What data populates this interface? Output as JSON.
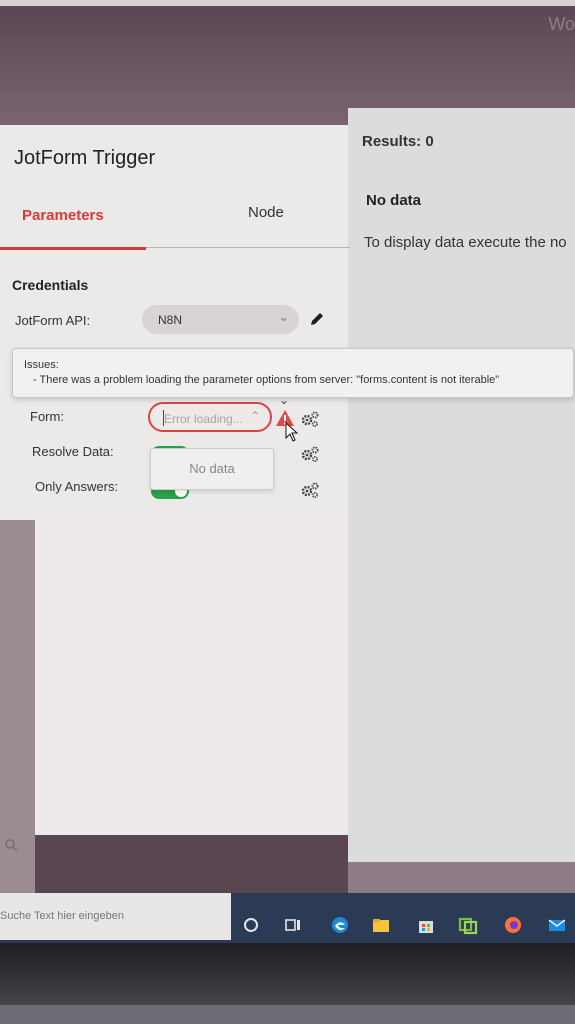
{
  "background": {
    "corner_text": "Wo"
  },
  "node": {
    "title": "JotForm Trigger"
  },
  "tabs": [
    {
      "label": "Parameters",
      "active": true
    },
    {
      "label": "Node",
      "active": false
    }
  ],
  "credentials": {
    "section_title": "Credentials",
    "api_label": "JotForm API:",
    "api_value": "N8N"
  },
  "issues": {
    "title": "Issues:",
    "message": "- There was a problem loading the parameter options from server: \"forms.content is not iterable\""
  },
  "form": {
    "label": "Form:",
    "placeholder": "Error loading...",
    "dropdown_empty": "No data"
  },
  "resolve_data": {
    "label": "Resolve Data:",
    "on": true
  },
  "only_answers": {
    "label": "Only Answers:",
    "on": true
  },
  "results": {
    "header": "Results: 0",
    "no_data_title": "No data",
    "no_data_message": "To display data execute the no"
  },
  "taskbar": {
    "search_placeholder": "Suche Text hier eingeben",
    "icons": [
      "cortana-icon",
      "task-view-icon",
      "edge-icon",
      "file-explorer-icon",
      "store-icon",
      "vpn-icon",
      "firefox-icon",
      "mail-icon"
    ]
  },
  "colors": {
    "accent": "#d93a3a",
    "toggle_on": "#27a14b",
    "warning": "#e04848"
  }
}
